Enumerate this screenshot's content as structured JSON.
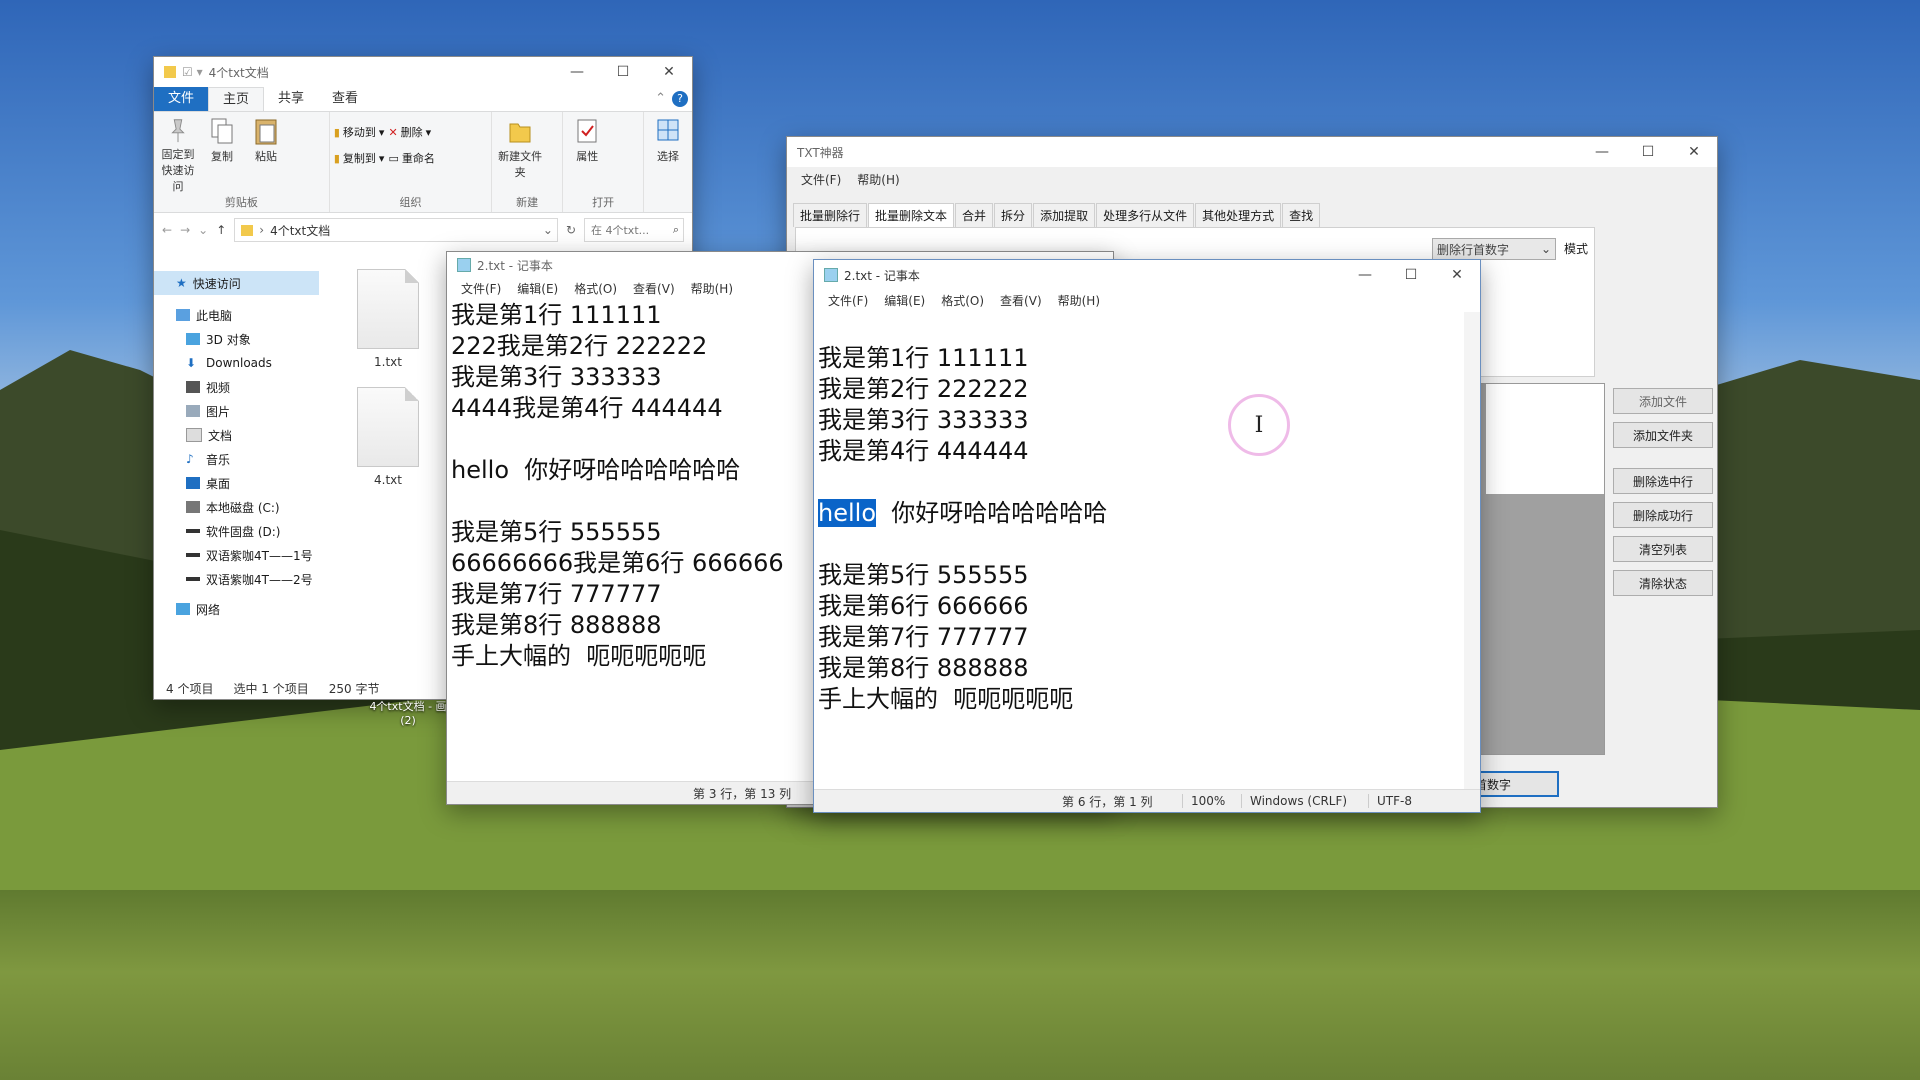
{
  "explorer": {
    "title": "4个txt文档",
    "tabs": [
      "文件",
      "主页",
      "共享",
      "查看"
    ],
    "ribbon": {
      "pin_label": "固定到快速访问",
      "copy_label": "复制",
      "paste_label": "粘贴",
      "clipboard_group": "剪贴板",
      "move_to": "移动到",
      "copy_to": "复制到",
      "delete": "删除",
      "rename": "重命名",
      "organize_group": "组织",
      "new_folder": "新建文件夹",
      "new_group": "新建",
      "properties": "属性",
      "open_group": "打开",
      "select": "选择"
    },
    "address": "4个txt文档",
    "search_placeholder": "在 4个txt...",
    "nav": [
      "快速访问",
      "此电脑",
      "3D 对象",
      "Downloads",
      "视频",
      "图片",
      "文档",
      "音乐",
      "桌面",
      "本地磁盘 (C:)",
      "软件固盘 (D:)",
      "双语紫咖4T——1号",
      "双语紫咖4T——2号",
      "网络"
    ],
    "files": [
      "1.txt",
      "4.txt"
    ],
    "status": {
      "count": "4 个项目",
      "selected": "选中 1 个项目",
      "size": "250 字节"
    }
  },
  "taskbar_tooltip": {
    "line1": "4个txt文档 - 画",
    "line2": "(2)"
  },
  "notepad_left": {
    "title": "2.txt - 记事本",
    "menu": [
      "文件(F)",
      "编辑(E)",
      "格式(O)",
      "查看(V)",
      "帮助(H)"
    ],
    "lines": [
      "我是第1行 111111",
      "222我是第2行 222222",
      "我是第3行 333333",
      "4444我是第4行 444444",
      "",
      "hello  你好呀哈哈哈哈哈哈",
      "",
      "我是第5行 555555",
      "66666666我是第6行 666666",
      "我是第7行 777777",
      "我是第8行 888888",
      "手上大幅的  呃呃呃呃呃"
    ],
    "status_pos": "第 3 行，第 13 列"
  },
  "notepad_right": {
    "title": "2.txt - 记事本",
    "menu": [
      "文件(F)",
      "编辑(E)",
      "格式(O)",
      "查看(V)",
      "帮助(H)"
    ],
    "lines": [
      "我是第1行 111111",
      "我是第2行 222222",
      "我是第3行 333333",
      "我是第4行 444444",
      "",
      "hello",
      "  你好呀哈哈哈哈哈哈",
      "",
      "我是第5行 555555",
      "我是第6行 666666",
      "我是第7行 777777",
      "我是第8行 888888",
      "手上大幅的  呃呃呃呃呃"
    ],
    "status": {
      "pos": "第 6 行，第 1 列",
      "zoom": "100%",
      "eol": "Windows (CRLF)",
      "enc": "UTF-8"
    }
  },
  "txt_tool": {
    "title": "TXT神器",
    "menu": [
      "文件(F)",
      "帮助(H)"
    ],
    "tabs": [
      "批量删除行",
      "批量删除文本",
      "合并",
      "拆分",
      "添加提取",
      "处理多行从文件",
      "其他处理方式",
      "查找"
    ],
    "mode_select": "删除行首数字",
    "mode_label": "模式",
    "buttons": [
      "添加文件",
      "添加文件夹",
      "删除选中行",
      "删除成功行",
      "清空列表",
      "清除状态"
    ],
    "action_button": "首数字"
  },
  "colors": {
    "accent": "#1f6fc2",
    "selection": "#0a64c8"
  }
}
